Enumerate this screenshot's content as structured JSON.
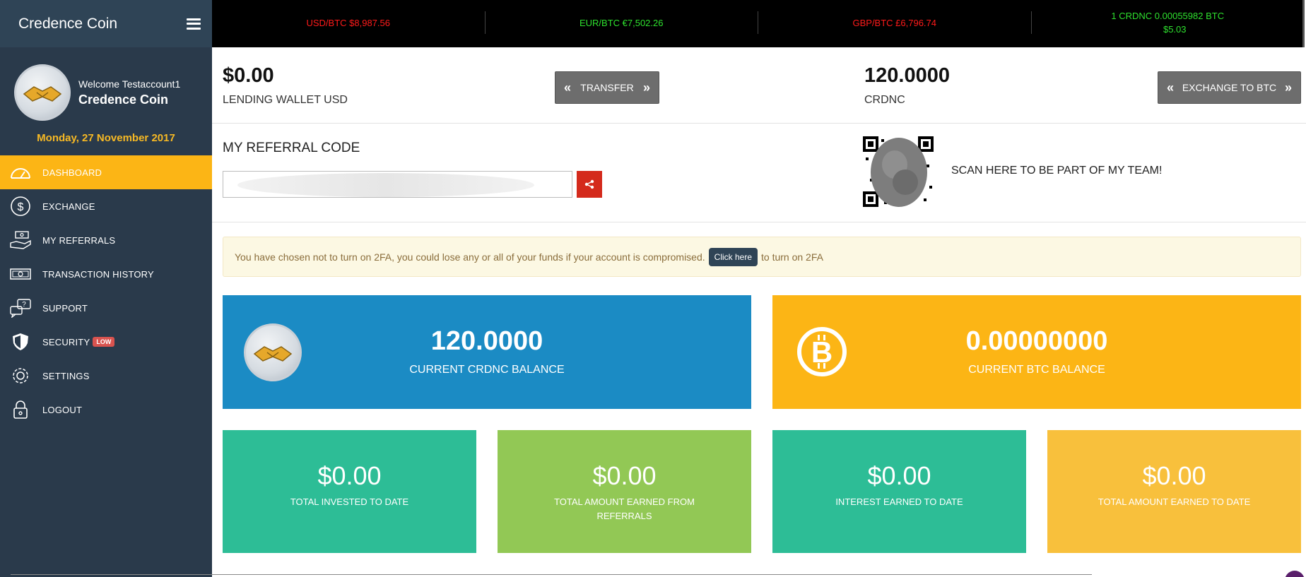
{
  "sidebar": {
    "brand_title": "Credence Coin",
    "welcome": "Welcome Testaccount1",
    "profile_name": "Credence Coin",
    "date": "Monday, 27 November 2017",
    "items": [
      {
        "label": "DASHBOARD",
        "icon": "speedometer-icon",
        "active": true
      },
      {
        "label": "EXCHANGE",
        "icon": "dollar-circle-icon"
      },
      {
        "label": "MY REFERRALS",
        "icon": "hand-money-icon"
      },
      {
        "label": "TRANSACTION HISTORY",
        "icon": "banknotes-icon"
      },
      {
        "label": "SUPPORT",
        "icon": "chat-question-icon"
      },
      {
        "label": "SECURITY",
        "icon": "shield-icon",
        "badge": "LOW"
      },
      {
        "label": "SETTINGS",
        "icon": "gear-icon"
      },
      {
        "label": "LOGOUT",
        "icon": "lock-icon"
      }
    ]
  },
  "ticker": {
    "usd_btc": "USD/BTC $8,987.56",
    "eur_btc": "EUR/BTC €7,502.26",
    "gbp_btc": "GBP/BTC £6,796.74",
    "crdnc_btc": "1 CRDNC 0.00055982 BTC",
    "crdnc_usd": "$5.03"
  },
  "wallet": {
    "lending_amount": "$0.00",
    "lending_label": "LENDING WALLET USD",
    "transfer_label": "TRANSFER",
    "crdnc_amount": "120.0000",
    "crdnc_label": "CRDNC",
    "exchange_label": "EXCHANGE TO BTC"
  },
  "referral": {
    "title": "MY REFERRAL CODE",
    "scan_text": "SCAN HERE TO BE PART OF MY TEAM!"
  },
  "alert": {
    "text_before": "You have chosen not to turn on 2FA, you could lose any or all of your funds if your account is compromised.",
    "button": "Click here",
    "text_after": "to turn on 2FA"
  },
  "balances": {
    "crdnc_value": "120.0000",
    "crdnc_label": "CURRENT CRDNC BALANCE",
    "btc_value": "0.00000000",
    "btc_label": "CURRENT BTC BALANCE"
  },
  "stats": [
    {
      "value": "$0.00",
      "label": "TOTAL INVESTED TO DATE",
      "color": "#2dbd96"
    },
    {
      "value": "$0.00",
      "label": "TOTAL AMOUNT EARNED FROM REFERRALS",
      "color": "#92c855"
    },
    {
      "value": "$0.00",
      "label": "INTEREST EARNED TO DATE",
      "color": "#2dbd96"
    },
    {
      "value": "$0.00",
      "label": "TOTAL AMOUNT EARNED TO DATE",
      "color": "#f8c03c"
    }
  ],
  "colors": {
    "sidebar_bg": "#2a3a4b",
    "accent_yellow": "#fcb515",
    "crdnc_card": "#1b8bc4",
    "btc_card": "#fcb515"
  }
}
